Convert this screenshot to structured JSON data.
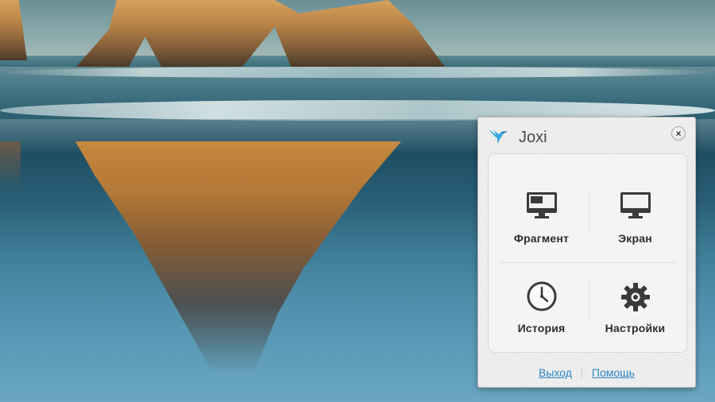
{
  "window": {
    "title": "Joxi",
    "close_label": "×"
  },
  "actions": [
    {
      "label": "Фрагмент",
      "icon": "fragment-screen-icon"
    },
    {
      "label": "Экран",
      "icon": "monitor-icon"
    },
    {
      "label": "История",
      "icon": "clock-icon"
    },
    {
      "label": "Настройки",
      "icon": "gear-icon"
    }
  ],
  "footer": {
    "exit_label": "Выход",
    "help_label": "Помощь"
  },
  "colors": {
    "link": "#2c86c4",
    "logo": "#39a9e0"
  }
}
